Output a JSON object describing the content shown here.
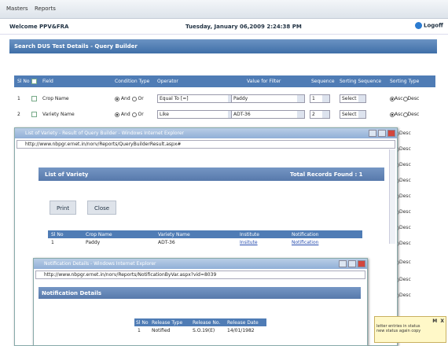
{
  "menu": {
    "masters": "Masters",
    "reports": "Reports"
  },
  "welcome": "Welcome PPV&FRA",
  "datetime": "Tuesday, January 06,2009 2:24:38 PM",
  "logoff": "Logoff",
  "section_title": "Search DUS Test Details - Query Builder",
  "query_table": {
    "headers": [
      "Sl No",
      "Field",
      "Condition Type",
      "Operator",
      "Value for Filter",
      "Sequence",
      "Sorting Sequence",
      "Sorting Type"
    ],
    "rows": [
      {
        "sl": "1",
        "field": "Crop Name",
        "and": "And",
        "or": "Or",
        "operator": "Equal To [=]",
        "value": "Paddy",
        "sequence": "1",
        "sorting": "Select",
        "asc": "Asc",
        "desc": "Desc"
      },
      {
        "sl": "2",
        "field": "Variety Name",
        "and": "And",
        "or": "Or",
        "operator": "Like",
        "value": "ADT-36",
        "sequence": "2",
        "sorting": "Select",
        "asc": "Asc",
        "desc": "Desc"
      }
    ],
    "extra_desc": "Desc"
  },
  "window1": {
    "title": "List of Variety - Result of Query Builder - Windows Internet Explorer",
    "url": "http://www.nbpgr.ernet.in/norv/Reports/QueryBuilderResult.aspx#",
    "list_title": "List of Variety",
    "total": "Total Records Found : 1",
    "print": "Print",
    "close": "Close",
    "table": {
      "headers": [
        "Sl No",
        "Crop Name",
        "Variety Name",
        "Institute",
        "Notification"
      ],
      "row": [
        "1",
        "Paddy",
        "ADT-36",
        "Insitute",
        "Notification"
      ]
    }
  },
  "window2": {
    "title": "Notification Details - Windows Internet Explorer",
    "url": "http://www.nbpgr.ernet.in/norv/Reports/NotificationByVar.aspx?vid=8039",
    "section": "Notification Details",
    "table": {
      "headers": [
        "Sl No",
        "Release Type",
        "Release No.",
        "Release Date"
      ],
      "row": [
        "1",
        "Notified",
        "S.O.19(E)",
        "14/01/1982"
      ]
    }
  },
  "popup": {
    "m": "M",
    "x": "X",
    "line1": "letter entries in status",
    "line2": "new status again copy"
  }
}
